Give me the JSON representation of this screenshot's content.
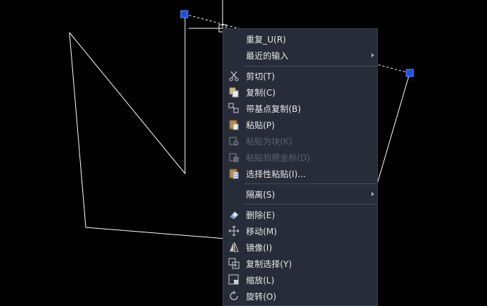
{
  "colors": {
    "canvas_bg": "#000000",
    "menu_bg": "#262d38",
    "grip": "#1f4fe0",
    "text": "#e6e8ea",
    "disabled_text": "#5b6470"
  },
  "menu": {
    "items": [
      {
        "label": "重复_U(R)",
        "icon": "none",
        "disabled": false,
        "submenu": false
      },
      {
        "label": "最近的输入",
        "icon": "none",
        "disabled": false,
        "submenu": true
      },
      {
        "label": "剪切(T)",
        "icon": "scissors-icon",
        "disabled": false,
        "submenu": false
      },
      {
        "label": "复制(C)",
        "icon": "copy-icon",
        "disabled": false,
        "submenu": false
      },
      {
        "label": "带基点复制(B)",
        "icon": "copy-base-point-icon",
        "disabled": false,
        "submenu": false
      },
      {
        "label": "粘贴(P)",
        "icon": "paste-icon",
        "disabled": false,
        "submenu": false
      },
      {
        "label": "粘贴为块(K)",
        "icon": "paste-as-block-icon",
        "disabled": true,
        "submenu": false
      },
      {
        "label": "粘贴到原坐标(D)",
        "icon": "paste-orig-coords-icon",
        "disabled": true,
        "submenu": false
      },
      {
        "label": "选择性粘贴(I)...",
        "icon": "paste-special-icon",
        "disabled": false,
        "submenu": false
      },
      {
        "label": "隔离(S)",
        "icon": "none",
        "disabled": false,
        "submenu": true
      },
      {
        "label": "删除(E)",
        "icon": "eraser-icon",
        "disabled": false,
        "submenu": false
      },
      {
        "label": "移动(M)",
        "icon": "move-icon",
        "disabled": false,
        "submenu": false
      },
      {
        "label": "镜像(I)",
        "icon": "mirror-icon",
        "disabled": false,
        "submenu": false
      },
      {
        "label": "复制选择(Y)",
        "icon": "copy-selection-icon",
        "disabled": false,
        "submenu": false
      },
      {
        "label": "缩放(L)",
        "icon": "scale-icon",
        "disabled": false,
        "submenu": false
      },
      {
        "label": "旋转(O)",
        "icon": "rotate-icon",
        "disabled": false,
        "submenu": false
      }
    ]
  }
}
